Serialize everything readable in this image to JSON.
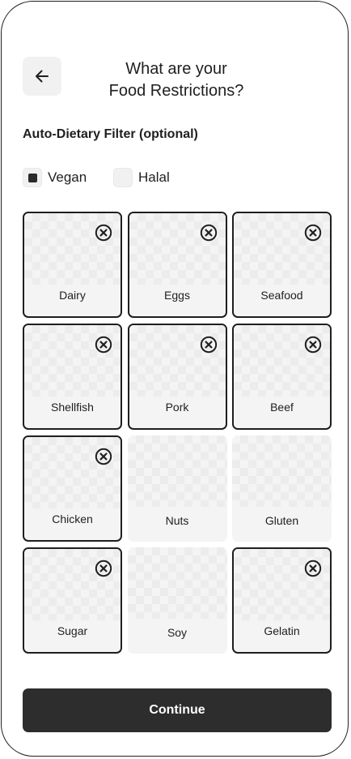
{
  "header": {
    "title_line1": "What are your",
    "title_line2": "Food Restrictions?",
    "back_icon": "arrow-left-icon"
  },
  "filters": {
    "section_label": "Auto-Dietary Filter (optional)",
    "items": [
      {
        "label": "Vegan",
        "checked": true
      },
      {
        "label": "Halal",
        "checked": false
      }
    ]
  },
  "restrictions": [
    {
      "label": "Dairy",
      "selected": true
    },
    {
      "label": "Eggs",
      "selected": true
    },
    {
      "label": "Seafood",
      "selected": true
    },
    {
      "label": "Shellfish",
      "selected": true
    },
    {
      "label": "Pork",
      "selected": true
    },
    {
      "label": "Beef",
      "selected": true
    },
    {
      "label": "Chicken",
      "selected": true
    },
    {
      "label": "Nuts",
      "selected": false
    },
    {
      "label": "Gluten",
      "selected": false
    },
    {
      "label": "Sugar",
      "selected": true
    },
    {
      "label": "Soy",
      "selected": false
    },
    {
      "label": "Gelatin",
      "selected": true
    }
  ],
  "remove_icon": "circle-x-icon",
  "footer": {
    "continue_label": "Continue"
  },
  "colors": {
    "primary": "#2d2d2d",
    "tile_bg": "#f4f4f4",
    "text": "#1f1f1f"
  }
}
